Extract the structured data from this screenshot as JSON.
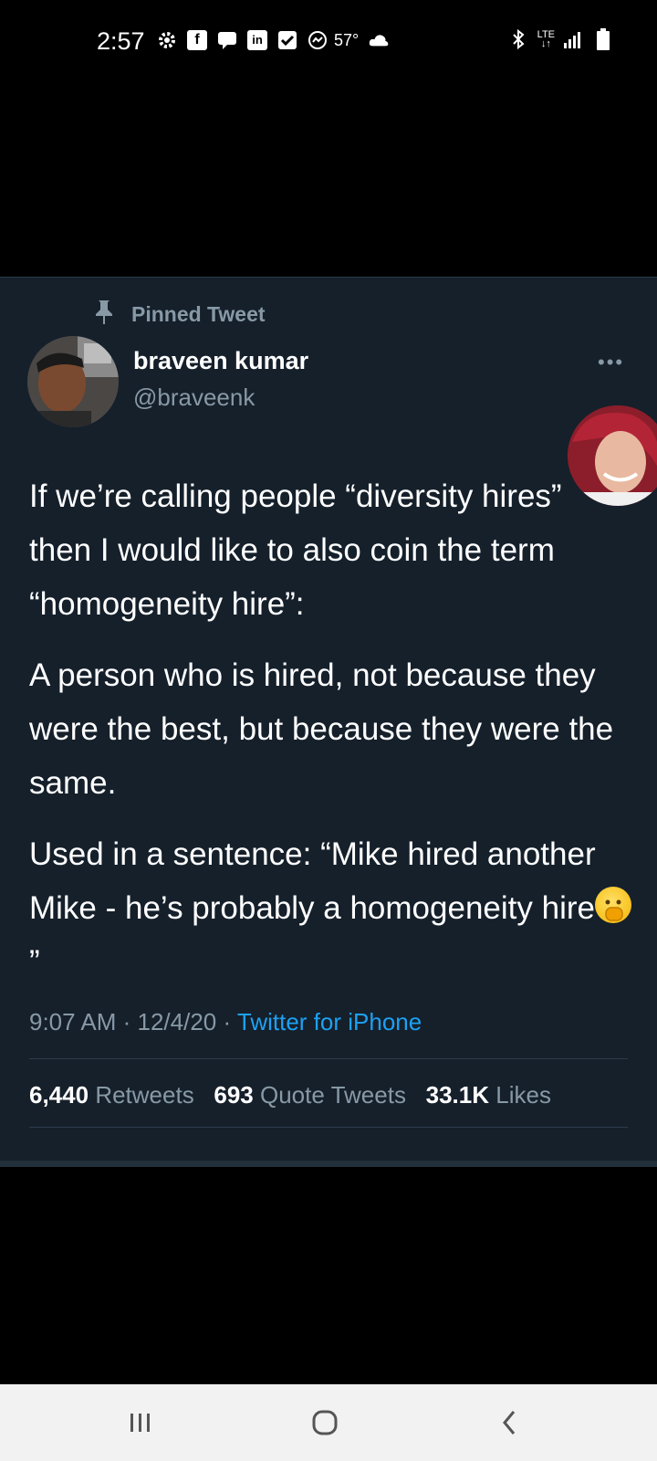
{
  "status_bar": {
    "time": "2:57",
    "temperature": "57°",
    "network": "LTE",
    "icons": [
      "gear-icon",
      "facebook-icon",
      "messenger-chat-icon",
      "linkedin-icon",
      "checkbox-icon",
      "messenger-icon",
      "cloud-icon",
      "bluetooth-icon",
      "signal-icon",
      "battery-icon"
    ]
  },
  "tweet": {
    "pinned_label": "Pinned Tweet",
    "author_name": "braveen kumar",
    "author_handle": "@braveenk",
    "paragraphs": [
      "If we’re calling people “diversity hires” then I would like to also coin the term “homogeneity hire”:",
      "A person who is hired, not because they were the best, but because they were the same.",
      "Used in a sentence: “Mike hired another Mike - he’s probably a homogeneity hire"
    ],
    "paragraph3_end": "”",
    "timestamp": "9:07 AM · 12/4/20 · ",
    "source": "Twitter for iPhone",
    "retweets_count": "6,440",
    "retweets_label": "Retweets",
    "quotes_count": "693",
    "quotes_label": "Quote Tweets",
    "likes_count": "33.1K",
    "likes_label": "Likes"
  },
  "colors": {
    "tweet_bg": "#15202b",
    "muted_text": "#8899a6",
    "link": "#1da1f2"
  }
}
